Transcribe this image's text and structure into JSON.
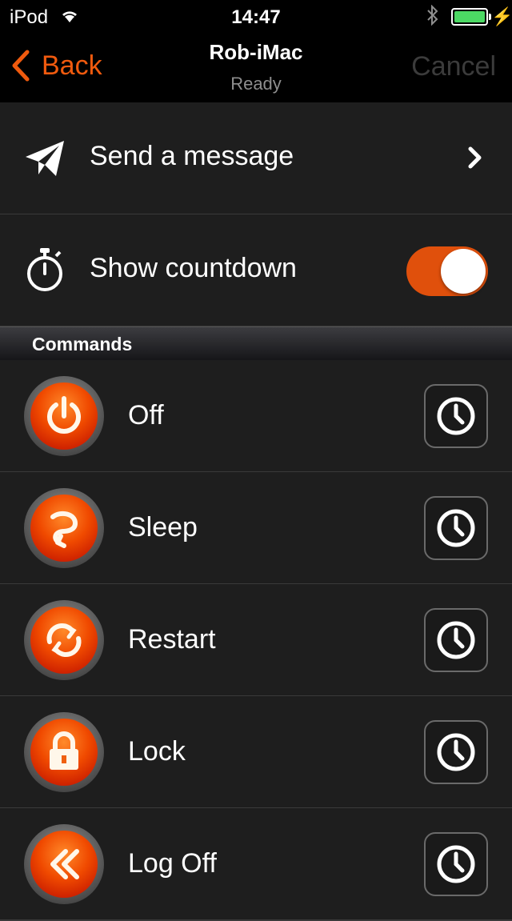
{
  "status": {
    "carrier": "iPod",
    "time": "14:47"
  },
  "nav": {
    "back_label": "Back",
    "title": "Rob-iMac",
    "subtitle": "Ready",
    "cancel_label": "Cancel"
  },
  "options": {
    "send_message": "Send a message",
    "show_countdown": "Show countdown",
    "countdown_on": true
  },
  "section_header": "Commands",
  "commands": [
    {
      "label": "Off"
    },
    {
      "label": "Sleep"
    },
    {
      "label": "Restart"
    },
    {
      "label": "Lock"
    },
    {
      "label": "Log Off"
    }
  ],
  "colors": {
    "accent": "#f05a0e",
    "toggle_on": "#e0500c",
    "battery": "#4cd964"
  }
}
